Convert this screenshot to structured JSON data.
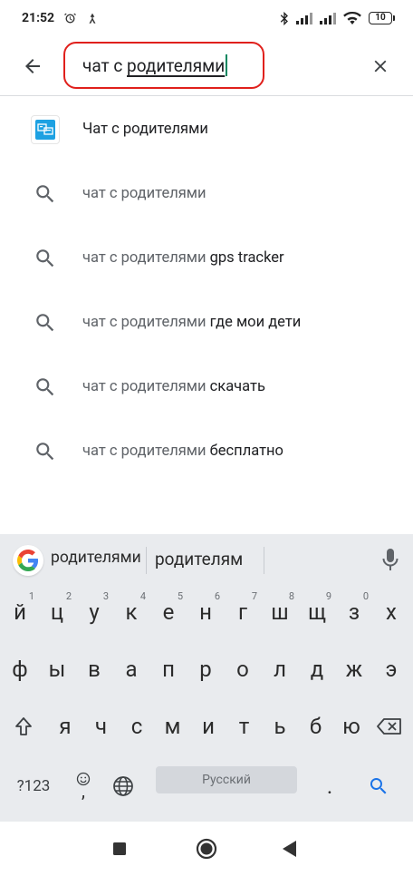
{
  "status_bar": {
    "time": "21:52",
    "battery": "10"
  },
  "search": {
    "prefix": "чат с ",
    "highlighted": "родителями"
  },
  "suggestions": [
    {
      "type": "app",
      "icon": "app-icon",
      "query": "",
      "completion": "Чат с родителями"
    },
    {
      "type": "query",
      "icon": "search-icon",
      "query": "чат с родителями",
      "completion": ""
    },
    {
      "type": "query",
      "icon": "search-icon",
      "query": "чат с родителями",
      "completion": " gps tracker"
    },
    {
      "type": "query",
      "icon": "search-icon",
      "query": "чат с родителями",
      "completion": " где мои дети"
    },
    {
      "type": "query",
      "icon": "search-icon",
      "query": "чат с родителями",
      "completion": " скачать"
    },
    {
      "type": "query",
      "icon": "search-icon",
      "query": "чат с родителями",
      "completion": " бесплатно"
    }
  ],
  "keyboard": {
    "suggestions": [
      "родителями",
      "родителям"
    ],
    "row1": [
      {
        "key": "й",
        "hint": "1"
      },
      {
        "key": "ц",
        "hint": "2"
      },
      {
        "key": "у",
        "hint": "3"
      },
      {
        "key": "к",
        "hint": "4"
      },
      {
        "key": "е",
        "hint": "5"
      },
      {
        "key": "н",
        "hint": "6"
      },
      {
        "key": "г",
        "hint": "7"
      },
      {
        "key": "ш",
        "hint": "8"
      },
      {
        "key": "щ",
        "hint": "9"
      },
      {
        "key": "з",
        "hint": "0"
      },
      {
        "key": "х",
        "hint": ""
      }
    ],
    "row2": [
      "ф",
      "ы",
      "в",
      "а",
      "п",
      "р",
      "о",
      "л",
      "д",
      "ж",
      "э"
    ],
    "row3": [
      "я",
      "ч",
      "с",
      "м",
      "и",
      "т",
      "ь",
      "б",
      "ю"
    ],
    "symbols_label": "?123",
    "comma": ",",
    "space_label": "Русский",
    "period": ".",
    "accent_color": "#1a73e8"
  },
  "colors": {
    "highlight_border": "#e0201c",
    "caret": "#01875f",
    "app_icon": "#1da1e2"
  }
}
